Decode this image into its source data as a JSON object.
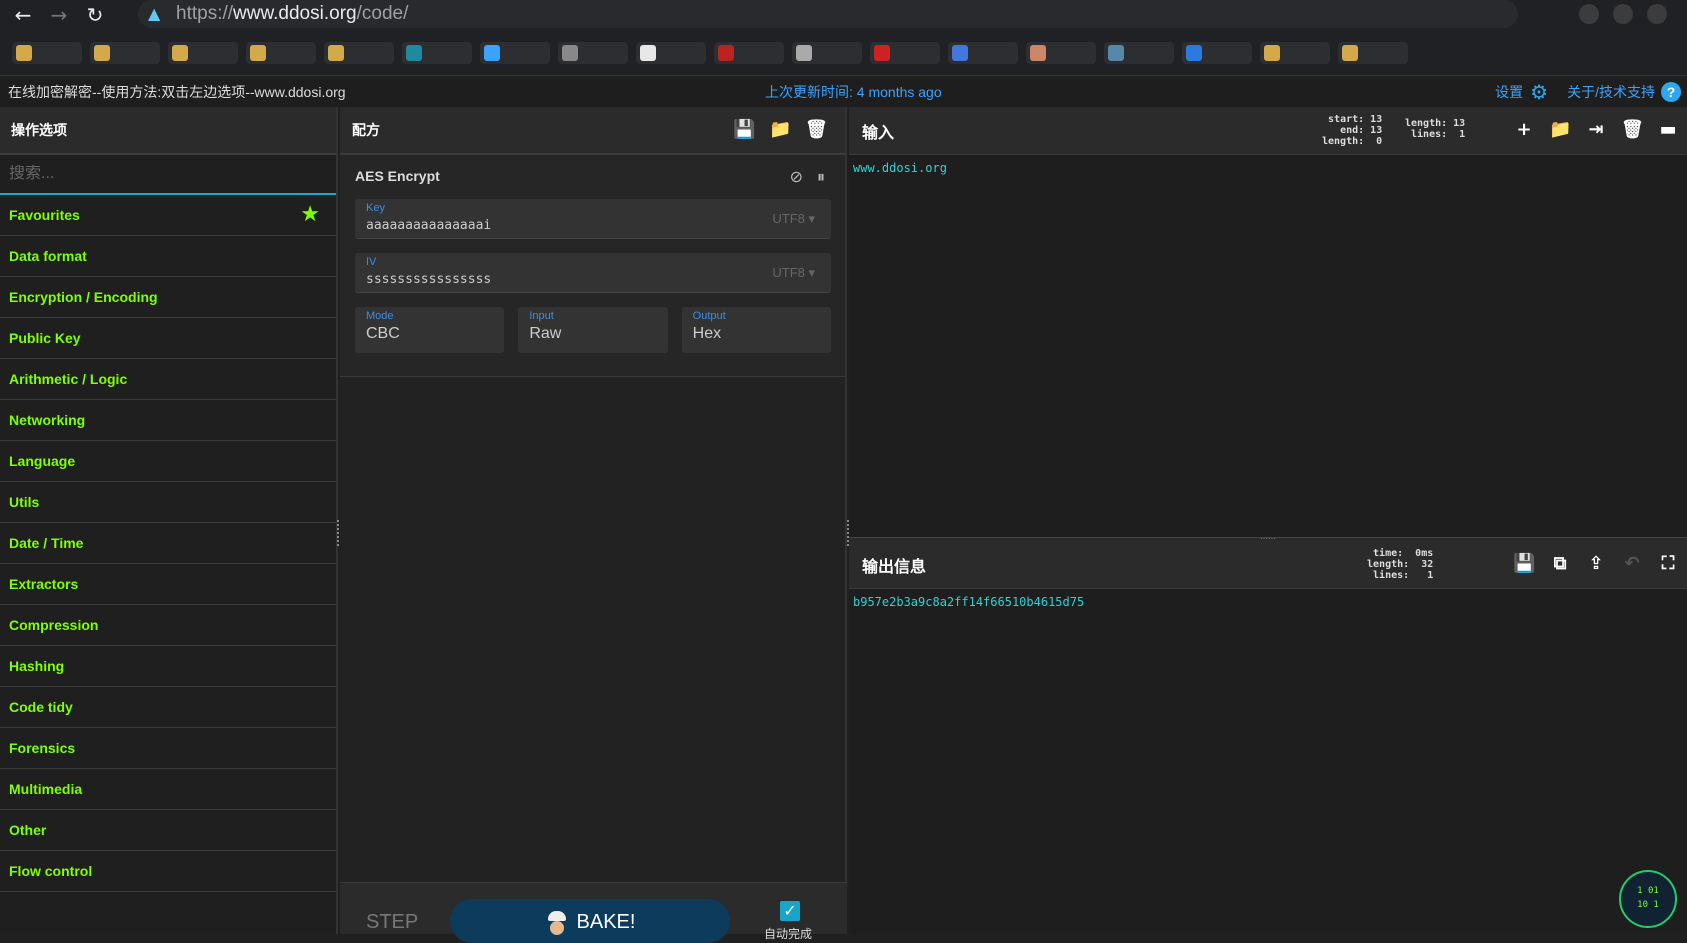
{
  "browser": {
    "url_scheme": "https://",
    "url_host": "www.ddosi.org",
    "url_path": "/code/",
    "back": "←",
    "forward": "→",
    "reload": "↻"
  },
  "banner": {
    "left": "在线加密解密--使用方法:双击左边选项--www.ddosi.org",
    "center": "上次更新时间: 4 months ago",
    "settings": "设置",
    "about": "关于/技术支持"
  },
  "operations": {
    "title": "操作选项",
    "search_placeholder": "搜索...",
    "categories": [
      "Favourites",
      "Data format",
      "Encryption / Encoding",
      "Public Key",
      "Arithmetic / Logic",
      "Networking",
      "Language",
      "Utils",
      "Date / Time",
      "Extractors",
      "Compression",
      "Hashing",
      "Code tidy",
      "Forensics",
      "Multimedia",
      "Other",
      "Flow control"
    ]
  },
  "recipe": {
    "title": "配方",
    "operation": {
      "name": "AES Encrypt",
      "key_label": "Key",
      "key_value": "aaaaaaaaaaaaaaai",
      "key_encoding": "UTF8",
      "iv_label": "IV",
      "iv_value": "ssssssssssssssss",
      "iv_encoding": "UTF8",
      "mode_label": "Mode",
      "mode_value": "CBC",
      "input_label": "Input",
      "input_value": "Raw",
      "output_label": "Output",
      "output_value": "Hex"
    },
    "step_label": "STEP",
    "bake_label": "BAKE!",
    "auto_bake_label": "自动完成"
  },
  "input": {
    "title": "输入",
    "stats_left": "start: 13\n  end: 13\nlength:  0",
    "stats_right": "length: 13\n lines:  1",
    "text": "www.ddosi.org"
  },
  "output": {
    "title": "输出信息",
    "stats": "  time:  0ms\nlength:  32\n lines:   1",
    "text": "b957e2b3a9c8a2ff14f66510b4615d75"
  },
  "logo": {
    "text": "1 01\n10 1"
  },
  "colors": {
    "category": "#7fff00",
    "accent_blue": "#3aa3ff",
    "output_text": "#2ed3d3",
    "bake_button": "#0d3b5b"
  }
}
